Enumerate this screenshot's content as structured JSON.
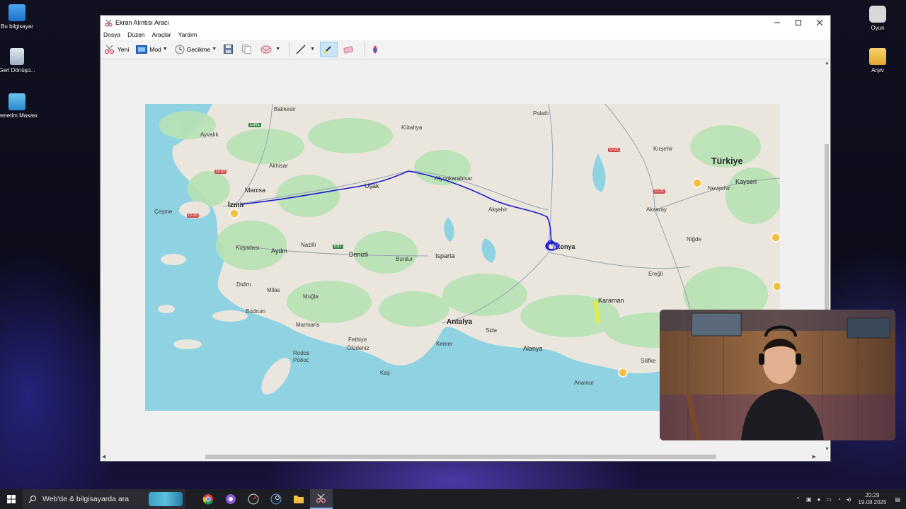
{
  "desktop": {
    "icons": [
      {
        "label": "Bu bilgisayar"
      },
      {
        "label": "Geri Dönüşü..."
      },
      {
        "label": "Denetim Masası"
      },
      {
        "label": "Oyun"
      },
      {
        "label": "Arşiv"
      }
    ]
  },
  "window": {
    "title": "Ekran Alıntısı Aracı",
    "menu": [
      "Dosya",
      "Düzen",
      "Araçlar",
      "Yardım"
    ],
    "toolbar": {
      "new_label": "Yeni",
      "mode_label": "Mod",
      "delay_label": "Gecikme"
    }
  },
  "map": {
    "country_label": "Türkiye",
    "cities": {
      "balikesir": "Balıkesir",
      "kutahya": "Kütahya",
      "polatli": "Polatlı",
      "ayvalik": "Ayvalık",
      "akhisar": "Akhisar",
      "manisa": "Manisa",
      "usak": "Uşak",
      "afyon": "Afyonkarahisar",
      "izmir": "İzmir",
      "cesme": "Çeşme",
      "aksehir": "Akşehir",
      "kirsehir": "Kırşehir",
      "kayseri": "Kayseri",
      "nevsehir": "Nevşehir",
      "aksaray": "Aksaray",
      "kusadasi": "Kuşadası",
      "aydin": "Aydın",
      "nazilli": "Nazilli",
      "denizli": "Denizli",
      "burdur": "Burdur",
      "isparta": "Isparta",
      "konya": "Konya",
      "nigde": "Niğde",
      "eregli": "Ereğli",
      "didim": "Didim",
      "milas": "Milas",
      "mugla": "Muğla",
      "karaman": "Karaman",
      "bodrum": "Bodrum",
      "marmaris": "Marmaris",
      "antalya": "Antalya",
      "side": "Side",
      "fethiye": "Fethiye",
      "oludeniz": "Ölüdeniz",
      "kemer": "Kemer",
      "alanya": "Alanya",
      "rodos": "Rodos",
      "rodos_gr": "Ρόδος",
      "kas": "Kaş",
      "anamur": "Anamur",
      "silifke": "Silifke"
    },
    "roads": {
      "e881": "E881",
      "o32a": "O-32",
      "o32b": "O-32",
      "e87": "E87",
      "o21a": "O-21",
      "o21b": "O-21"
    }
  },
  "taskbar": {
    "search_placeholder": "Web'de & bilgisayarda ara",
    "time": "20:29",
    "date": "19.08.2025"
  },
  "colors": {
    "route": "#1a1ad6",
    "highlight": "#e8ee2a",
    "sea": "#8fd3e3",
    "land": "#eae6dd",
    "green": "#b8e2b4"
  }
}
